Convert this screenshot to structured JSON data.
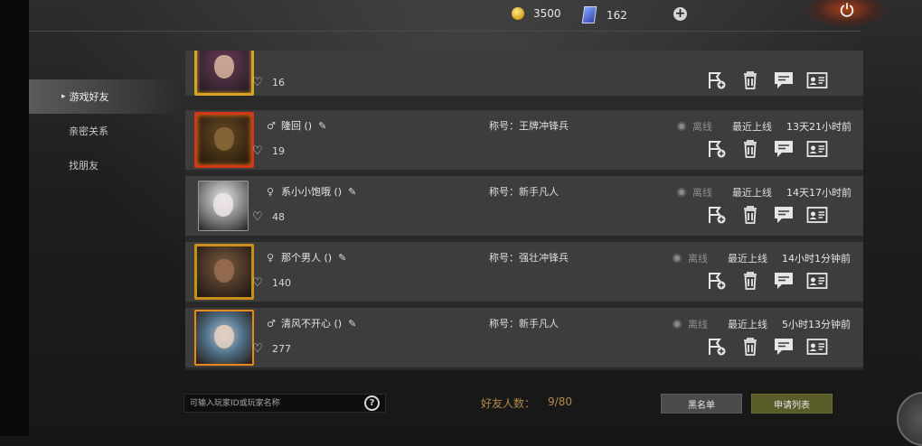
{
  "topbar": {
    "gold": "3500",
    "cards": "162",
    "add_label": "+"
  },
  "nav": {
    "items": [
      {
        "label": "游戏好友"
      },
      {
        "label": "亲密关系"
      },
      {
        "label": "找朋友"
      }
    ]
  },
  "friends": [
    {
      "name": "",
      "gender": "♀",
      "likes": "16",
      "title": "",
      "offline": "",
      "recent": "",
      "ago": ""
    },
    {
      "name": "隆回 ()",
      "gender": "♂",
      "likes": "19",
      "title": "称号：王牌冲锋兵",
      "offline": "离线",
      "recent": "最近上线",
      "ago": "13天21小时前"
    },
    {
      "name": "系小小饱哦 ()",
      "gender": "♀",
      "likes": "48",
      "title": "称号：新手凡人",
      "offline": "离线",
      "recent": "最近上线",
      "ago": "14天17小时前"
    },
    {
      "name": "那个男人 ()",
      "gender": "♀",
      "likes": "140",
      "title": "称号：强壮冲锋兵",
      "offline": "离线",
      "recent": "最近上线",
      "ago": "14小时1分钟前"
    },
    {
      "name": "清风不开心 ()",
      "gender": "♂",
      "likes": "277",
      "title": "称号：新手凡人",
      "offline": "离线",
      "recent": "最近上线",
      "ago": "5小时13分钟前"
    }
  ],
  "icons": {
    "gold": "coin-icon",
    "cards": "card-icon",
    "power": "power-icon",
    "like": "heart-icon",
    "edit": "pencil-icon",
    "invite": "flag-plus-icon",
    "delete": "trash-icon",
    "chat": "chat-icon",
    "profile": "id-card-icon"
  },
  "footer": {
    "search_placeholder": "可输入玩家ID或玩家名称",
    "search_button": "?",
    "friend_count_label": "好友人数：",
    "friend_count_value": "9/80",
    "blacklist_label": "黑名单",
    "requests_label": "申请列表"
  },
  "colors": {
    "accent_gold": "#d6a41e",
    "count_text": "#b08a4a",
    "requests_button": "#5a5c2a"
  }
}
